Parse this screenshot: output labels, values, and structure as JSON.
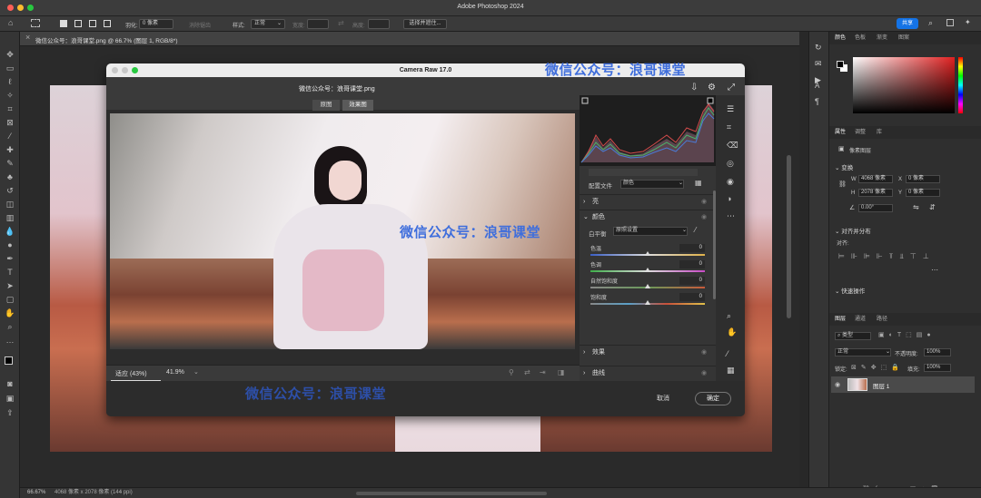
{
  "app": {
    "title": "Adobe Photoshop 2024",
    "share_label": "共享"
  },
  "options_bar": {
    "feather_label": "羽化:",
    "feather_value": "0 像素",
    "antialias_label": "消除锯齿",
    "style_label": "样式:",
    "style_value": "正常",
    "width_label": "宽度:",
    "height_label": "高度:",
    "select_mask_label": "选择并遮住..."
  },
  "document": {
    "tab_title": "微信公众号：浪哥课堂.png @ 66.7% (图层 1, RGB/8*)"
  },
  "status_bar": {
    "zoom": "66.67%",
    "info": "4068 像素 x 2078 像素 (144 ppi)"
  },
  "camera_raw": {
    "window_title": "Camera Raw 17.0",
    "filename": "微信公众号：浪哥课堂.png",
    "view_before": "原图",
    "view_after": "效果图",
    "fit_label": "适应 (43%)",
    "zoom_value": "41.9%",
    "profile_label": "配置文件",
    "profile_value": "颜色",
    "sections": {
      "light": "亮",
      "color": "颜色",
      "effects": "效果",
      "curve": "曲线"
    },
    "white_balance_label": "白平衡",
    "white_balance_value": "原照设置",
    "sliders": [
      {
        "label": "色温",
        "value": "0"
      },
      {
        "label": "色调",
        "value": "0"
      },
      {
        "label": "自然饱和度",
        "value": "0"
      },
      {
        "label": "饱和度",
        "value": "0"
      }
    ],
    "cancel_label": "取消",
    "ok_label": "确定"
  },
  "watermark": {
    "text": "微信公众号：浪哥课堂"
  },
  "right_panel": {
    "color_tabs": [
      "颜色",
      "色板",
      "渐变",
      "图案"
    ],
    "props_tabs": [
      "属性",
      "调整",
      "库"
    ],
    "pixel_layer": "像素图层",
    "transform_title": "变换",
    "w_label": "W",
    "w_value": "4068 像素",
    "h_label": "H",
    "h_value": "2078 像素",
    "x_label": "X",
    "x_value": "0 像素",
    "y_label": "Y",
    "y_value": "0 像素",
    "angle_value": "0.00°",
    "align_title": "对齐并分布",
    "align_label": "对齐:",
    "quick_actions": "快速操作",
    "layer_tabs": [
      "图层",
      "通道",
      "路径"
    ],
    "layer_filter": "类型",
    "blend_mode": "正常",
    "opacity_label": "不透明度:",
    "opacity_value": "100%",
    "lock_label": "锁定:",
    "fill_label": "填充:",
    "fill_value": "100%",
    "layer_name": "图层 1"
  },
  "colors": {
    "accent": "#1473e6",
    "watermark": "#3f6edc",
    "slider_thumb": "#dddddd"
  }
}
